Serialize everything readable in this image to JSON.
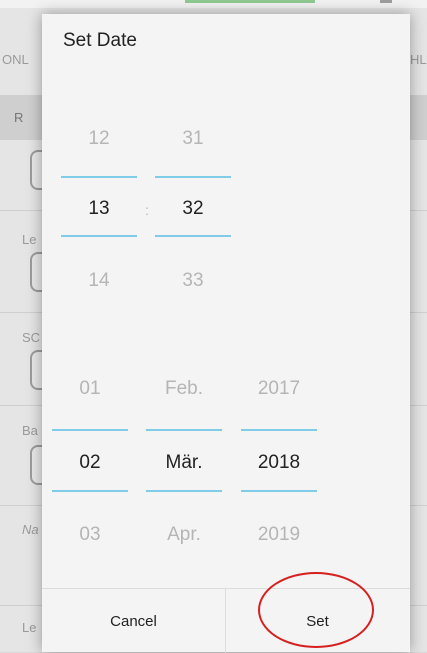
{
  "dialog": {
    "title": "Set Date",
    "time": {
      "hour": {
        "prev": "12",
        "current": "13",
        "next": "14"
      },
      "minute": {
        "prev": "31",
        "current": "32",
        "next": "33"
      },
      "separator": ":"
    },
    "date": {
      "day": {
        "prev": "01",
        "current": "02",
        "next": "03"
      },
      "month": {
        "prev": "Feb.",
        "current": "Mär.",
        "next": "Apr."
      },
      "year": {
        "prev": "2017",
        "current": "2018",
        "next": "2019"
      }
    },
    "buttons": {
      "cancel": "Cancel",
      "set": "Set"
    }
  },
  "background": {
    "labels": [
      "ONL",
      "HL",
      "R",
      "Le",
      "SC",
      "Ba",
      "Na",
      "Le"
    ]
  },
  "colors": {
    "accent_line": "#7fcbe8",
    "annotation": "#d62020"
  }
}
